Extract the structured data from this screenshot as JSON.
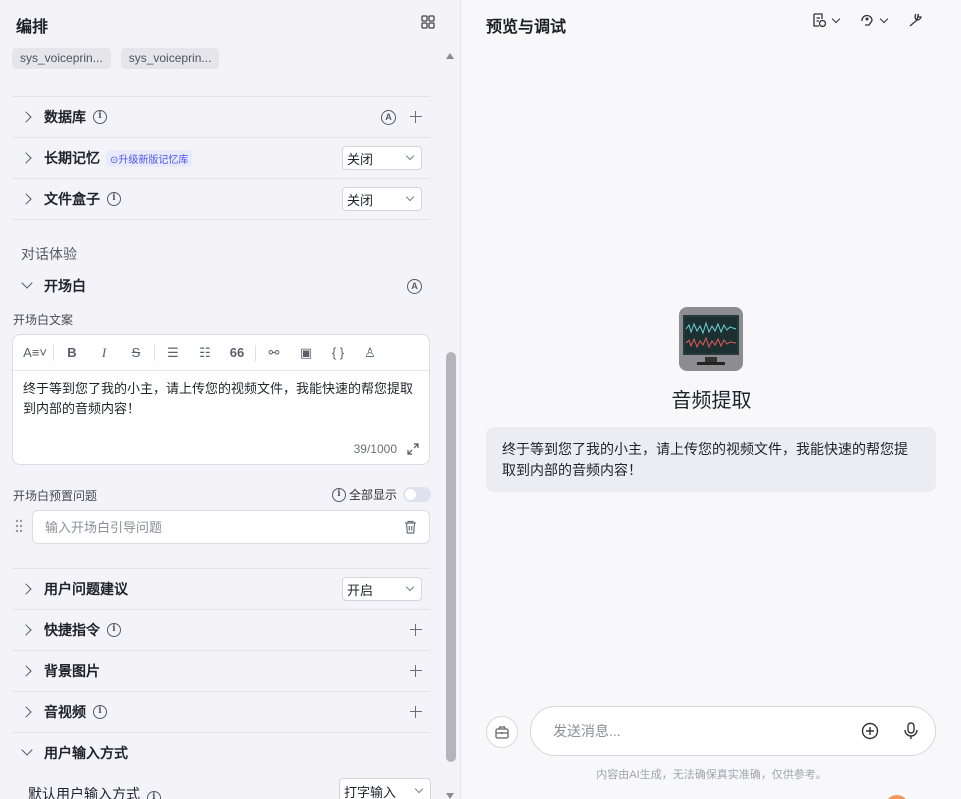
{
  "left": {
    "title": "编排",
    "tags": [
      "sys_voiceprin...",
      "sys_voiceprin..."
    ],
    "rows": {
      "database": "数据库",
      "memory": "长期记忆",
      "memory_badge": "升级新版记忆库",
      "memory_select": "关闭",
      "filebox": "文件盒子",
      "filebox_select": "关闭",
      "opener": "开场白",
      "suggest": "用户问题建议",
      "suggest_select": "开启",
      "shortcut": "快捷指令",
      "background": "背景图片",
      "av": "音视频",
      "input_method": "用户输入方式"
    },
    "section_dialog": "对话体验",
    "opener_text_label": "开场白文案",
    "editor": {
      "text": "终于等到您了我的小主，请上传您的视频文件，我能快速的帮您提取到内部的音频内容！",
      "counter": "39/1000"
    },
    "preset_label": "开场白预置问题",
    "show_all": "全部显示",
    "question_placeholder": "输入开场白引导问题",
    "default_input_label": "默认用户输入方式",
    "default_input_value": "打字输入"
  },
  "right": {
    "title": "预览与调试",
    "bot_name": "音频提取",
    "bubble": "终于等到您了我的小主，请上传您的视频文件，我能快速的帮您提取到内部的音频内容！",
    "message_placeholder": "发送消息...",
    "disclaimer": "内容由AI生成，无法确保真实准确，仅供参考。"
  }
}
